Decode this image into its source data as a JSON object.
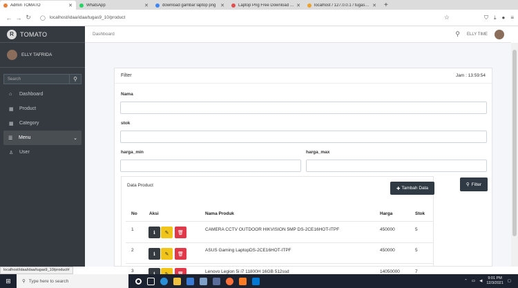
{
  "browser": {
    "tabs": [
      {
        "title": "Admin TOMATO",
        "color": "#e8803a",
        "active": true
      },
      {
        "title": "WhatsApp",
        "color": "#25d366",
        "active": false
      },
      {
        "title": "download gambar laptop png",
        "color": "#4285f4",
        "active": false
      },
      {
        "title": "Laptop Png Free Download - A",
        "color": "#e05050",
        "active": false
      },
      {
        "title": "localhost / 127.0.0.1 / tugas_dp",
        "color": "#f0a030",
        "active": false
      }
    ],
    "url": "localhost/idaa/idaa/tugas9_10/product",
    "status_url": "localhost/idaa/idaa/tugas9_10/product#"
  },
  "sidebar": {
    "brand": "TOMATO",
    "user": "ELLY TAFRIDA",
    "search_placeholder": "Search",
    "items": [
      {
        "label": "Dashboard",
        "icon": "home-icon",
        "glyph": "⌂"
      },
      {
        "label": "Product",
        "icon": "grid-icon",
        "glyph": "▦"
      },
      {
        "label": "Category",
        "icon": "table-icon",
        "glyph": "▦"
      },
      {
        "label": "Menu",
        "icon": "list-icon",
        "glyph": "☰",
        "active": true
      },
      {
        "label": "User",
        "icon": "user-icon",
        "glyph": "♙"
      }
    ]
  },
  "header": {
    "breadcrumb": "Dashboard",
    "user": "ELLY TIME"
  },
  "filter": {
    "title": "Filter",
    "time": "Jam : 13:59:54",
    "labels": {
      "nama": "Nama",
      "stok": "stok",
      "harga_min": "harga_min",
      "harga_max": "harga_max"
    },
    "button": "Filter"
  },
  "products": {
    "title": "Data Product",
    "add_button": "Tambah Data",
    "columns": [
      "No",
      "Aksi",
      "Nama Produk",
      "Harga",
      "Stok"
    ],
    "rows": [
      {
        "no": "1",
        "name": "CAMERA CCTV OUTDOOR HIKVISION 5MP DS-2CE16HOT-ITPF",
        "price": "450000",
        "stock": "5"
      },
      {
        "no": "2",
        "name": "ASUS Gaming LaptopDS-2CE16HOT-ITPF",
        "price": "450000",
        "stock": "5"
      },
      {
        "no": "3",
        "name": "Lenovo Legion 5i i7 11800H 16GB 512ssd",
        "price": "14050000",
        "stock": "7"
      }
    ]
  },
  "taskbar": {
    "search_placeholder": "Type here to search",
    "time": "9:01 PM",
    "date": "12/3/2021"
  }
}
